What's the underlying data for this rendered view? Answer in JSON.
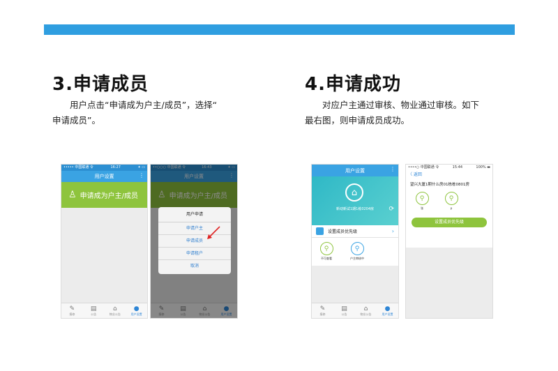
{
  "colors": {
    "top_bar": "#2f9ee0",
    "green": "#8ec43d",
    "blue": "#3aa3e3"
  },
  "step3": {
    "title": "3.申请成员",
    "desc_line1": "用户点击“申请成为户主/成员”，选择“",
    "desc_line2": "申请成员”。"
  },
  "step4": {
    "title": "4.申请成功",
    "desc_line1": "对应户主通过审核、物业通过审核。如下",
    "desc_line2": "最右图，则申请成员成功。"
  },
  "phone1": {
    "status_left": "••••• 中国联通 令",
    "status_time": "16:27",
    "status_right": "✦ ▭",
    "nav_title": "用户设置",
    "more": "⋮",
    "apply_label": "申请成为户主/成员",
    "tabs": [
      {
        "icon": "✎",
        "label": "报修"
      },
      {
        "icon": "▤",
        "label": "公告"
      },
      {
        "icon": "⌂",
        "label": "物业公告"
      },
      {
        "icon": "●",
        "label": "用户设置"
      }
    ]
  },
  "phone2": {
    "status_left": "••○○○ 中国联通 令",
    "status_time": "16:43",
    "status_right": "✦ ▭",
    "nav_title": "用户设置",
    "more": "⋮",
    "apply_label": "申请成为户主/成员",
    "dialog_title": "用户申请",
    "options": [
      "申请户主",
      "申请成员",
      "申请租户",
      "取消"
    ],
    "tabs": [
      {
        "icon": "✎",
        "label": "报修"
      },
      {
        "icon": "▤",
        "label": "公告"
      },
      {
        "icon": "⌂",
        "label": "物业公告"
      },
      {
        "icon": "●",
        "label": "用户设置"
      }
    ]
  },
  "phone3": {
    "nav_title": "用户设置",
    "more": "⋮",
    "hero_text": "新动新试1期1栋0204房",
    "priority_label": "设置成员优先级",
    "members": [
      {
        "icon": "⚲",
        "label": "不可查看"
      },
      {
        "icon": "⚲",
        "label": "户主审核中"
      }
    ],
    "tabs": [
      {
        "icon": "✎",
        "label": "报修"
      },
      {
        "icon": "▤",
        "label": "公告"
      },
      {
        "icon": "⌂",
        "label": "物业公告"
      },
      {
        "icon": "●",
        "label": "用户设置"
      }
    ]
  },
  "phone4": {
    "status_left": "••••○ 中国联通 令",
    "status_time": "15:44",
    "status_right": "100% ▬",
    "back_label": "〈 返回",
    "address": "望兴大厦1期什么房01栋栋0801房",
    "members": [
      {
        "icon": "⚲",
        "label": "张"
      },
      {
        "icon": "⚲",
        "label": "p"
      }
    ],
    "button_label": "设置成员优先级"
  }
}
